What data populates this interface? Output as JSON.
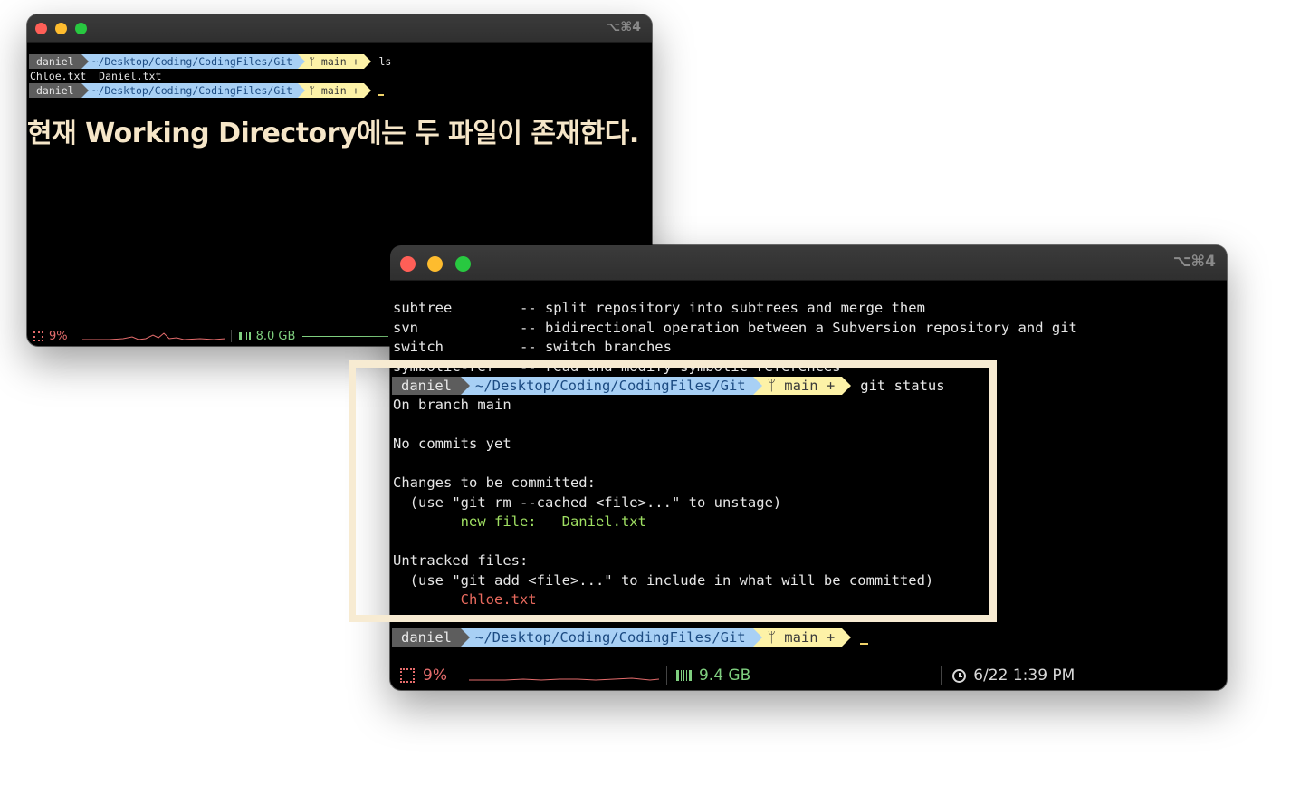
{
  "back_window": {
    "shortcut": "⌥⌘4",
    "prompt_user": "daniel",
    "prompt_path": "~/Desktop/Coding/CodingFiles/Git",
    "prompt_branch": "ᛘ main +",
    "command1": "ls",
    "output1": "Chloe.txt  Daniel.txt",
    "overlay_caption": "현재 Working Directory에는 두 파일이 존재한다.",
    "status": {
      "cpu": "9%",
      "mem": "8.0 GB"
    }
  },
  "front_window": {
    "shortcut": "⌥⌘4",
    "help_lines": [
      "subtree        -- split repository into subtrees and merge them",
      "svn            -- bidirectional operation between a Subversion repository and git",
      "switch         -- switch branches",
      "symbolic-ref   -- read and modify symbolic references"
    ],
    "prompt_user": "daniel",
    "prompt_path": "~/Desktop/Coding/CodingFiles/Git",
    "prompt_branch": "ᛘ main +",
    "command": "git status",
    "output": {
      "on_branch": "On branch main",
      "no_commits": "No commits yet",
      "changes_header": "Changes to be committed:",
      "changes_hint": "  (use \"git rm --cached <file>...\" to unstage)",
      "new_file": "        new file:   Daniel.txt",
      "untracked_header": "Untracked files:",
      "untracked_hint": "  (use \"git add <file>...\" to include in what will be committed)",
      "untracked_file": "        Chloe.txt"
    },
    "status": {
      "cpu": "9%",
      "mem": "9.4 GB",
      "clock": "6/22 1:39 PM"
    }
  },
  "colors": {
    "highlight_border": "#f7ebd2",
    "caption": "#f6e6c8",
    "staged_file": "#9fdf62",
    "untracked_file": "#e86a5e"
  },
  "icons": [
    "cpu-icon",
    "memory-icon",
    "clock-icon",
    "branch-icon"
  ]
}
